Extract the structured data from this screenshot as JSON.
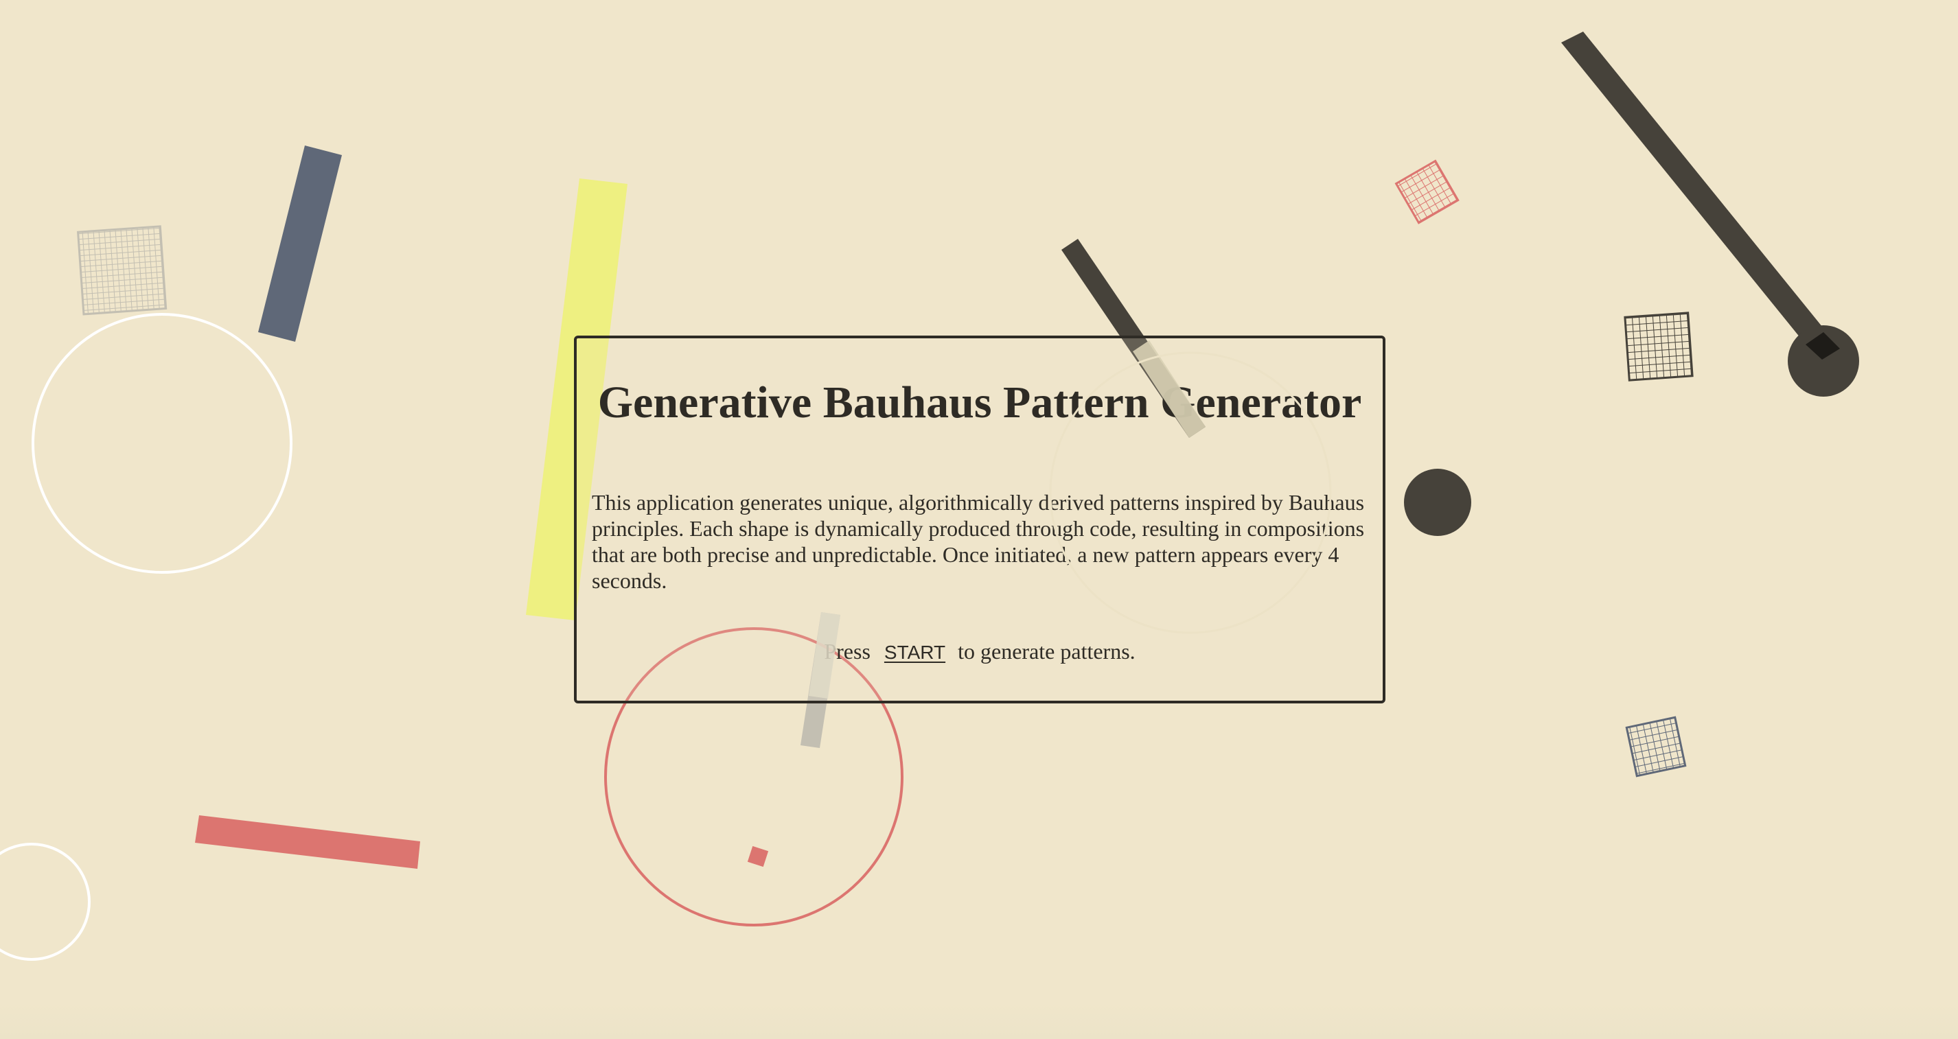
{
  "page": {
    "title": "Generative Bauhaus Pattern Generator",
    "description": "This application generates unique, algorithmically derived patterns inspired by Bauhaus principles. Each shape is dynamically produced through code, resulting in compositions that are both precise and unpredictable. Once initiated, a new pattern appears every 4 seconds.",
    "cta": {
      "before": "Press",
      "start_label": "START",
      "after": "to generate patterns."
    }
  },
  "colors": {
    "background": "#f0e6cb",
    "text": "#2e2b25",
    "charcoal": "#46423a",
    "slate": "#5f6878",
    "yellow": "#eef081",
    "coral": "#dc7570",
    "light_gray": "#c3bfb2",
    "white": "#ffffff"
  }
}
